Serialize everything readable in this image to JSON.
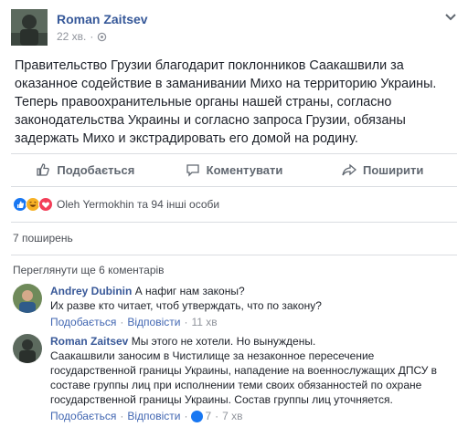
{
  "post": {
    "author": "Roman Zaitsev",
    "time": "22 хв.",
    "body": "Правительство Грузии благодарит поклонников Саакашвили за\nоказанное содействие в заманивании Михо на территорию Украины.\nТеперь правоохранительные органы нашей страны, согласно\nзаконодательства Украины и согласно запроса Грузии, обязаны\nзадержать Михо и экстрадировать его домой на родину."
  },
  "actions": {
    "like": "Подобається",
    "comment": "Коментувати",
    "share": "Поширити"
  },
  "reactions": {
    "summary": "Oleh Yermokhin та 94 інші особи",
    "icons": [
      "like-icon",
      "haha-icon",
      "love-icon"
    ]
  },
  "shares": "7 поширень",
  "view_more": "Переглянути ще 6 коментарів",
  "comments": [
    {
      "author": "Andrey Dubinin",
      "text": "А нафиг нам законы?\nИх разве кто читает, чтоб утверждать, что по закону?",
      "like": "Подобається",
      "reply": "Відповісти",
      "time": "11 хв"
    },
    {
      "author": "Roman Zaitsev",
      "text": "Мы этого не хотели. Но вынуждены.\nСаакашвили заносим в Чистилище за незаконное пересечение\nгосударственной границы Украины, нападение на военнослужащих ДПСУ в\nсоставе группы лиц при исполнении теми своих обязанностей по охране\nгосударственной границы Украины. Состав группы лиц уточняется.",
      "like": "Подобається",
      "reply": "Відповісти",
      "reaction_count": "7",
      "time": "7 хв"
    }
  ],
  "colors": {
    "link": "#365899",
    "meta": "#90949c",
    "like_blue": "#1877f2"
  }
}
